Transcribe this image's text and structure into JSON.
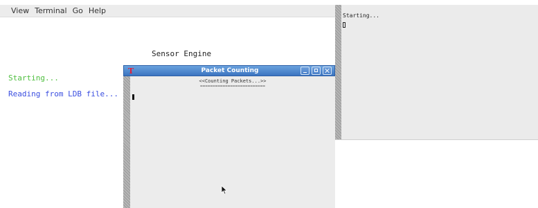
{
  "menu": {
    "items": [
      "View",
      "Terminal",
      "Go",
      "Help"
    ]
  },
  "main_terminal": {
    "title_line": "Sensor Engine",
    "status_line": "Starting...",
    "reading_line": "Reading from LDB file..."
  },
  "right_terminal": {
    "status_line": "Starting..."
  },
  "dialog": {
    "app_icon_glyph": "T",
    "title": "Packet Counting",
    "header": "<<Counting Packets...>>",
    "rule": "=========================="
  },
  "colors": {
    "status_green": "#4fbf3f",
    "reading_blue": "#3a4ee0",
    "titlebar_blue": "#3b74c0",
    "app_icon_red": "#e0203a"
  }
}
